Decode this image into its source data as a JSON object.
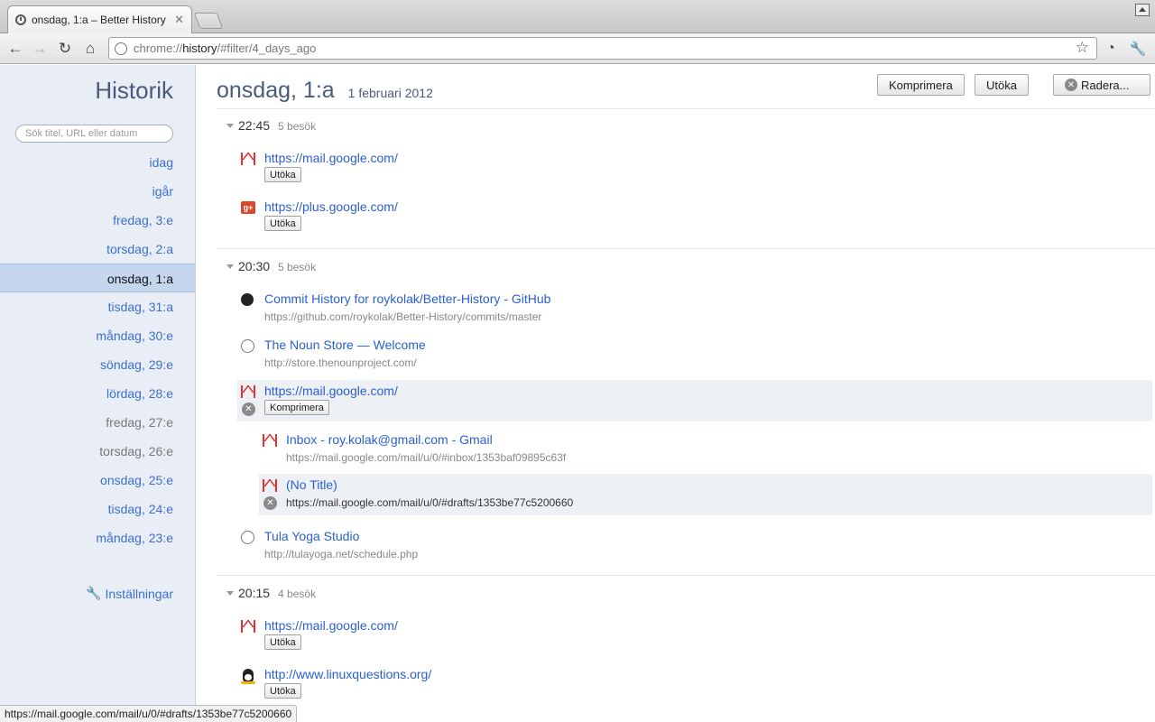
{
  "tab": {
    "title": "onsdag, 1:a – Better History"
  },
  "address": {
    "scheme": "chrome://",
    "host": "history",
    "path": "/#filter/4_days_ago"
  },
  "sidebar": {
    "title": "Historik",
    "search_placeholder": "Sök titel, URL eller datum",
    "days": [
      {
        "label": "idag"
      },
      {
        "label": "igår"
      },
      {
        "label": "fredag, 3:e"
      },
      {
        "label": "torsdag, 2:a"
      },
      {
        "label": "onsdag, 1:a"
      },
      {
        "label": "tisdag, 31:a"
      },
      {
        "label": "måndag, 30:e"
      },
      {
        "label": "söndag, 29:e"
      },
      {
        "label": "lördag, 28:e"
      },
      {
        "label": "fredag, 27:e"
      },
      {
        "label": "torsdag, 26:e"
      },
      {
        "label": "onsdag, 25:e"
      },
      {
        "label": "tisdag, 24:e"
      },
      {
        "label": "måndag, 23:e"
      }
    ],
    "selected_day": "onsdag, 1:a",
    "settings_label": "Inställningar"
  },
  "header": {
    "title": "onsdag, 1:a",
    "date": "1 februari 2012",
    "compress_label": "Komprimera",
    "expand_label": "Utöka",
    "delete_label": "Radera..."
  },
  "slots": [
    {
      "time": "22:45",
      "count": "5 besök",
      "visits": [
        {
          "icon": "gmail-icon",
          "title": "https://mail.google.com/",
          "button": "Utöka"
        },
        {
          "icon": "google-plus-icon",
          "title": "https://plus.google.com/",
          "button": "Utöka"
        }
      ]
    },
    {
      "time": "20:30",
      "count": "5 besök",
      "visits": [
        {
          "icon": "github-icon",
          "title": "Commit History for roykolak/Better-History - GitHub",
          "url": "https://github.com/roykolak/Better-History/commits/master"
        },
        {
          "icon": "globe-icon",
          "title": "The Noun Store — Welcome",
          "url": "http://store.thenounproject.com/"
        },
        {
          "icon": "gmail-icon",
          "title": "https://mail.google.com/",
          "button": "Komprimera"
        },
        {
          "icon": "gmail-icon",
          "title": "Inbox - roy.kolak@gmail.com - Gmail",
          "url": "https://mail.google.com/mail/u/0/#inbox/1353baf09895c63f"
        },
        {
          "icon": "gmail-icon",
          "title": "(No Title)",
          "url": "https://mail.google.com/mail/u/0/#drafts/1353be77c5200660"
        },
        {
          "icon": "globe-icon",
          "title": "Tula Yoga Studio",
          "url": "http://tulayoga.net/schedule.php"
        }
      ]
    },
    {
      "time": "20:15",
      "count": "4 besök",
      "visits": [
        {
          "icon": "gmail-icon",
          "title": "https://mail.google.com/",
          "button": "Utöka"
        },
        {
          "icon": "tux-icon",
          "title": "http://www.linuxquestions.org/",
          "button": "Utöka"
        }
      ]
    }
  ],
  "status_url": "https://mail.google.com/mail/u/0/#drafts/1353be77c5200660",
  "colors": {
    "link": "#2a5fcf",
    "heading": "#4a5a7a",
    "selected_bg": "#c5d6ef",
    "sidebar_bg": "#e9eef6"
  }
}
